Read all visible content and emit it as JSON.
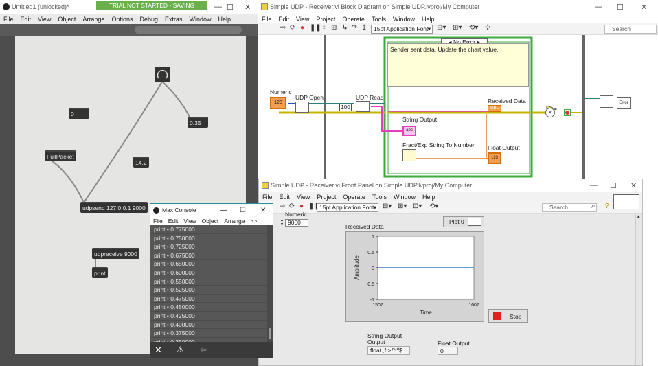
{
  "max": {
    "title": "Untitled1 (unlocked)*",
    "banner": "TRIAL NOT STARTED - SAVING DISABLED",
    "menu": [
      "File",
      "Edit",
      "View",
      "Object",
      "Arrange",
      "Options",
      "Debug",
      "Extras",
      "Window",
      "Help"
    ],
    "objects": {
      "num_zero": "0",
      "num_float": "0.35",
      "full_packet": "FullPacket",
      "num_14": "14.2",
      "udpsend": "udpsend 127.0.0.1 9000",
      "udpreceive": "udpreceive 9000",
      "print": "print"
    }
  },
  "console": {
    "title": "Max Console",
    "menu": [
      "File",
      "Edit",
      "View",
      "Object",
      "Arrange",
      ">>"
    ],
    "rows": [
      "print  •  0.775000",
      "print  •  0.750000",
      "print  •  0.725000",
      "print  •  0.675000",
      "print  •  0.650000",
      "print  •  0.600000",
      "print  •  0.550000",
      "print  •  0.525000",
      "print  •  0.475000",
      "print  •  0.450000",
      "print  •  0.425000",
      "print  •  0.400000",
      "print  •  0.375000",
      "print  •  0.350000"
    ]
  },
  "bd": {
    "title": "Simple UDP - Receiver.vi Block Diagram on Simple UDP.lvproj/My Computer",
    "menu": [
      "File",
      "Edit",
      "View",
      "Project",
      "Operate",
      "Tools",
      "Window",
      "Help"
    ],
    "font": "15pt Application Font",
    "search_placeholder": "Search",
    "case": "No Error",
    "comment": "Sender sent data. Update the chart value.",
    "labels": {
      "numeric": "Numeric",
      "udp_open": "UDP Open",
      "udp_read": "UDP Read",
      "const_100": "100",
      "received_data": "Received Data",
      "string_output": "String Output",
      "fract_exp": "Fract/Exp String To Number",
      "float_output": "Float Output",
      "error": "Error"
    }
  },
  "fp": {
    "title": "Simple UDP - Receiver.vi Front Panel on Simple UDP.lvproj/My Computer",
    "menu": [
      "File",
      "Edit",
      "View",
      "Project",
      "Operate",
      "Tools",
      "Window",
      "Help"
    ],
    "font": "15pt Application Font",
    "search_placeholder": "Search",
    "numeric_label": "Numeric",
    "numeric_value": "9000",
    "received_data": "Received Data",
    "plot_label": "Plot 0",
    "stop": "Stop",
    "string_output_label1": "String Output",
    "string_output_label2": "Output",
    "string_output_value": "float  ,f  >™º$",
    "float_output_label": "Float Output",
    "float_output_value": "0"
  },
  "chart_data": {
    "type": "line",
    "title": "",
    "xlabel": "Time",
    "ylabel": "Amplitude",
    "xlim": [
      1507,
      1607
    ],
    "ylim": [
      -1,
      1
    ],
    "yticks": [
      "1",
      "0.5",
      "0",
      "-0.5",
      "-1"
    ],
    "xticks": [
      "1507",
      "1607"
    ],
    "series": [
      {
        "x": [
          1507,
          1607
        ],
        "y": [
          0,
          0
        ],
        "color": "#3a78c2"
      }
    ]
  }
}
